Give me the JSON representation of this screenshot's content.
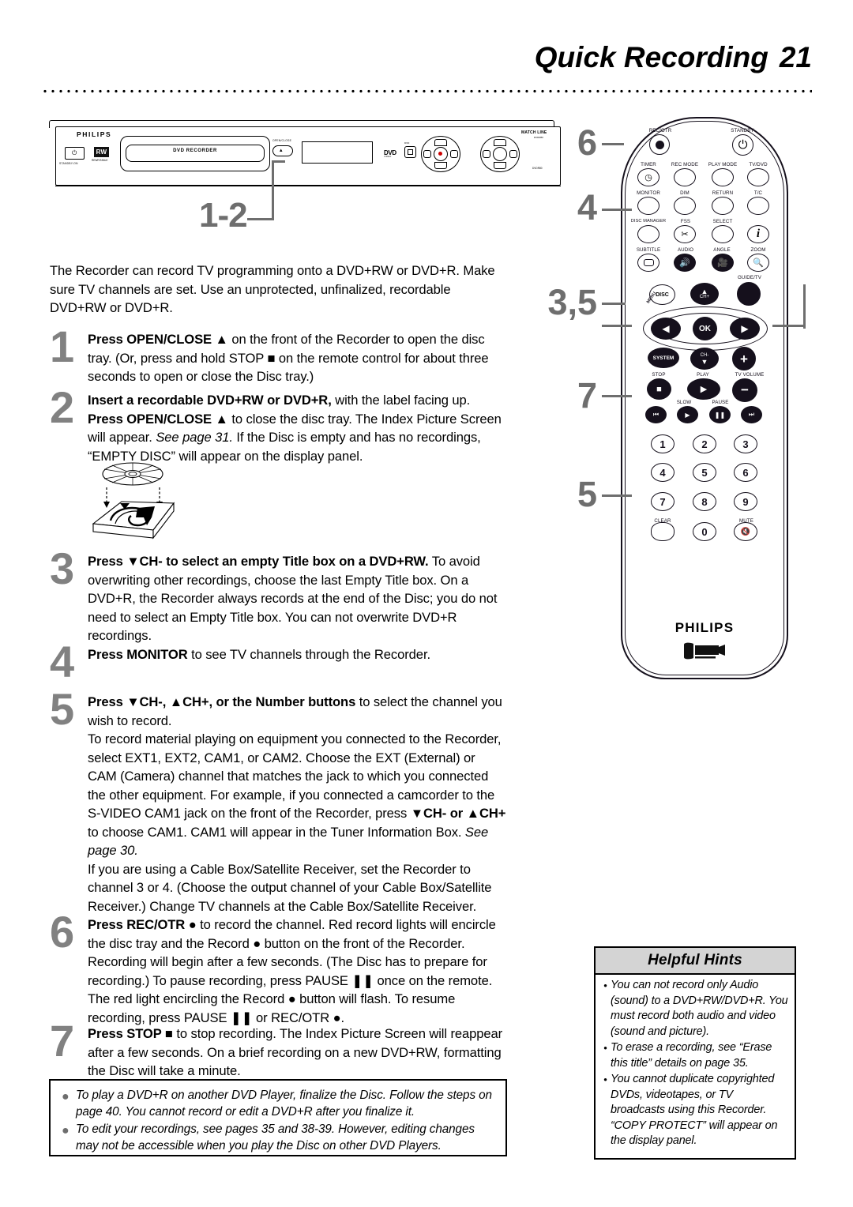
{
  "header": {
    "title": "Quick Recording",
    "page_number": "21"
  },
  "recorder": {
    "brand": "PHILIPS",
    "power_label": "STANDBY-ON",
    "rw_badge": "RW",
    "rw_label": "REWRITABLE",
    "tray_text": "DVD RECORDER",
    "open_close_label": "OPEN/CLOSE",
    "dvd_logo": "DVD",
    "dvd_sub": "VIDEO",
    "dvd_square_label": "DVD",
    "matchline": "MATCH LINE",
    "matchline_sub": "DVDR80",
    "dvdr_label": "DVDR80",
    "callout": "1-2"
  },
  "intro": "The Recorder can record TV programming onto a DVD+RW or DVD+R. Make sure TV channels are set. Use an unprotected, unfinalized, recordable DVD+RW or DVD+R.",
  "steps": [
    {
      "number": "1",
      "html": "<b>Press OPEN/CLOSE ▲</b> on the front of the Recorder to open the disc tray. (Or, press and hold STOP ■ on the remote control for about three seconds to open or close the Disc tray.)"
    },
    {
      "number": "2",
      "html": "<b>Insert a recordable DVD+RW or DVD+R,</b> with the label facing up. <b>Press OPEN/CLOSE ▲</b> to close the disc tray. The Index Picture Screen will appear. <i>See page 31.</i> If the Disc is empty and has no recordings, “EMPTY DISC” will appear on the display panel."
    },
    {
      "number": "3",
      "html": "<b>Press ▼CH- to select an empty Title box on a DVD+RW.</b> To avoid overwriting other recordings, choose the last Empty Title box. On a DVD+R, the Recorder always records at the end of the Disc; you do not need to select an Empty Title box. You can not overwrite DVD+R recordings."
    },
    {
      "number": "4",
      "html": "<b>Press MONITOR</b> to see TV channels through the Recorder."
    },
    {
      "number": "5",
      "html": "<b>Press ▼CH-, ▲CH+, or the Number buttons</b> to select the channel you wish to record.<br>To record material playing on equipment you connected to the Recorder, select EXT1, EXT2, CAM1, or CAM2. Choose the EXT (External) or CAM (Camera) channel that matches the jack to which you connected the other equipment. For example, if you connected a camcorder to the S-VIDEO CAM1 jack on the front of the Recorder, press <b>▼CH- or ▲CH+</b> to choose CAM1. CAM1 will appear in the Tuner Information Box. <i>See page 30.</i><br>If you are using a Cable Box/Satellite Receiver, set the Recorder to channel 3 or 4. (Choose the output channel of your Cable Box/Satellite Receiver.) Change TV channels at the Cable Box/Satellite Receiver."
    },
    {
      "number": "6",
      "html": "<b>Press REC/OTR ●</b> to record the channel. Red record lights will encircle the disc tray and the Record ● button on the front of the Recorder. Recording will begin after a few seconds. (The Disc has to prepare for recording.) To pause recording, press PAUSE ❚❚ once on the remote. The red light encircling the Record ● button will flash. To resume recording, press PAUSE ❚❚ or REC/OTR ●."
    },
    {
      "number": "7",
      "html": "<b>Press STOP ■</b> to stop recording. The Index Picture Screen will reappear after a few seconds. On a brief recording on a new DVD+RW, formatting the Disc will take a minute."
    }
  ],
  "notes": [
    "To play a DVD+R on another DVD Player, finalize the Disc. Follow the steps on page 40. You cannot record or edit a DVD+R after you finalize it.",
    "To edit your recordings, see pages 35 and 38-39. However, editing changes may not be accessible when you play the Disc on other DVD Players."
  ],
  "hints": {
    "title": "Helpful Hints",
    "bullet": "•",
    "items": [
      "You can not record only Audio (sound) to a DVD+RW/DVD+R. You must record both audio and video (sound and picture).",
      "To erase a recording, see “Erase this title” details on page 35.",
      "You cannot duplicate copyrighted DVDs, videotapes, or TV broadcasts using this Recorder. “COPY PROTECT” will appear on the display panel."
    ]
  },
  "remote": {
    "brand": "PHILIPS",
    "buttons": {
      "rec_otr": "REC/OTR",
      "standby": "STANDBY",
      "timer": "TIMER",
      "rec_mode": "REC MODE",
      "play_mode": "PLAY MODE",
      "tv_dvd": "TV/DVD",
      "monitor": "MONITOR",
      "dim": "DIM",
      "return": "RETURN",
      "tc": "T/C",
      "disc_manager": "DISC MANAGER",
      "fss": "FSS",
      "select": "SELECT",
      "info": "i",
      "subtitle": "SUBTITLE",
      "audio": "AUDIO",
      "angle": "ANGLE",
      "zoom": "ZOOM",
      "disc": "DISC",
      "ch_plus": "CH+",
      "guide_tv": "GUIDE/TV",
      "menu": "MENU",
      "ok": "OK",
      "system": "SYSTEM",
      "ch_minus": "CH-",
      "stop": "STOP",
      "play": "PLAY",
      "tv_volume": "TV VOLUME",
      "slow": "SLOW",
      "pause": "PAUSE",
      "clear": "CLEAR",
      "mute": "MUTE"
    },
    "numbers": [
      "1",
      "2",
      "3",
      "4",
      "5",
      "6",
      "7",
      "8",
      "9",
      "0"
    ]
  },
  "callouts": {
    "top": "6",
    "second": "4",
    "third": "3,5",
    "fourth": "7",
    "fifth": "5"
  },
  "colors": {
    "callout_gray": "#6e6e6e",
    "step_number_gray": "#818181",
    "hints_header": "#d4d4d4",
    "remote_outline": "#15101c",
    "record_red": "#cc0000"
  }
}
